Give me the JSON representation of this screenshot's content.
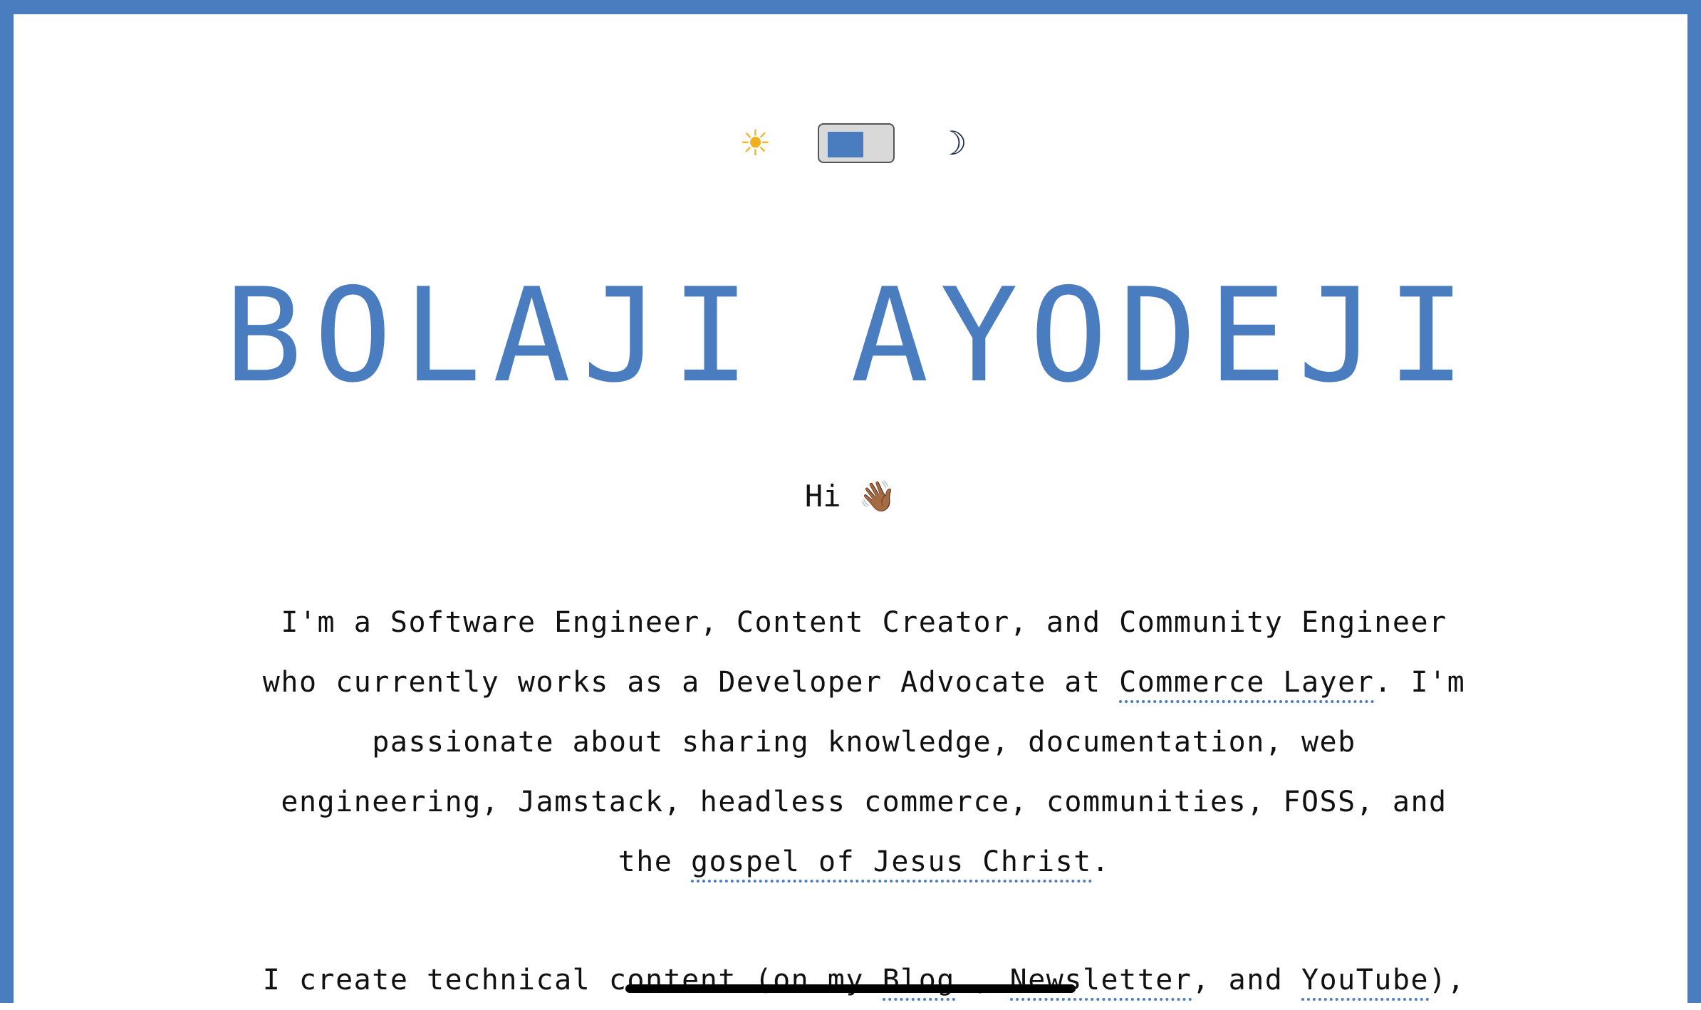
{
  "theme": {
    "light_icon": "sun-icon",
    "dark_icon": "moon-icon",
    "light_glyph": "☀",
    "dark_glyph": "☽",
    "accent": "#4a7dbf"
  },
  "header": {
    "title": "BOLAJI AYODEJI"
  },
  "greeting": {
    "text": "Hi",
    "emoji": "👋🏾"
  },
  "bio": {
    "p1_before": "I'm a Software Engineer, Content Creator, and Community Engineer who currently works as a Developer Advocate at ",
    "p1_link_company": "Commerce Layer",
    "p1_middle": ". I'm passionate about sharing knowledge, documentation, web engineering, Jamstack, headless commerce, communities, FOSS, and the ",
    "p1_link_gospel": "gospel of Jesus Christ",
    "p1_end": ".",
    "p2_before": "I create technical content (on my ",
    "p2_link_blog": "Blog",
    "p2_sep1": " , ",
    "p2_link_newsletter": "Newsletter",
    "p2_sep2": ", and ",
    "p2_link_youtube": "YouTube",
    "p2_end": "),"
  }
}
